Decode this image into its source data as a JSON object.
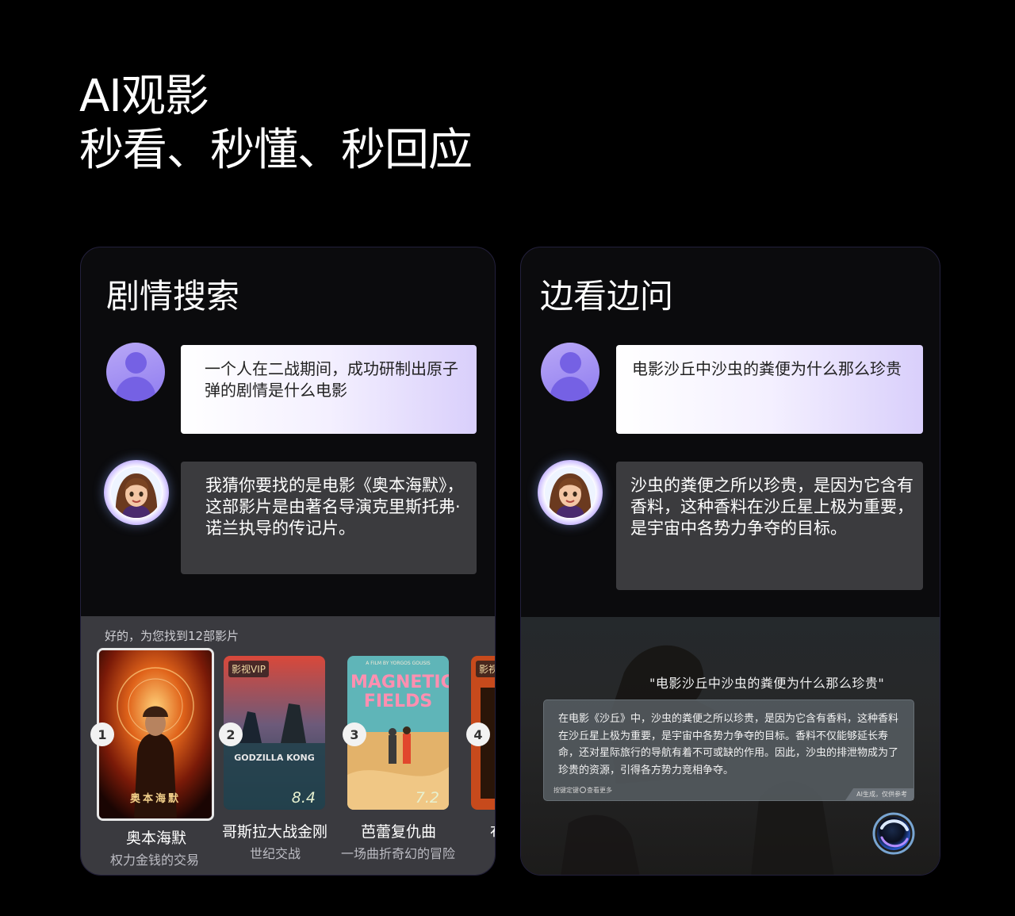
{
  "hero": {
    "line1": "AI观影",
    "line2": "秒看、秒懂、秒回应"
  },
  "left_panel": {
    "title": "剧情搜索",
    "user_message": "一个人在二战期间，成功研制出原子弹的剧情是什么电影",
    "ai_message": "我猜你要找的是电影《奥本海默》，这部影片是由著名导演克里斯托弗·诺兰执导的传记片。",
    "results_caption": "好的，为您找到12部影片",
    "vip_badge": "影视VIP",
    "movies": [
      {
        "rank": "1",
        "title": "奥本海默",
        "tag": "权力金钱的交易",
        "poster_title": "奥本海默",
        "selected": true
      },
      {
        "rank": "2",
        "title": "哥斯拉大战金刚",
        "tag": "世纪交战",
        "rating": "8.4",
        "poster_title": "GODZILLA KONG"
      },
      {
        "rank": "3",
        "title": "芭蕾复仇曲",
        "tag": "一场曲折奇幻的冒险",
        "rating": "7.2",
        "poster_title": "MAGNETIC FIELDS",
        "poster_subtitle": "A FILM BY YORGOS GOUSIS"
      },
      {
        "rank": "4",
        "title": "布",
        "tag": "命"
      }
    ]
  },
  "right_panel": {
    "title": "边看边问",
    "user_message": "电影沙丘中沙虫的粪便为什么那么珍贵",
    "ai_message": "沙虫的粪便之所以珍贵，是因为它含有香料，这种香料在沙丘星上极为重要，是宇宙中各势力争夺的目标。",
    "scene_question": "\"电影沙丘中沙虫的粪便为什么那么珍贵\"",
    "answer_text": "在电影《沙丘》中，沙虫的粪便之所以珍贵，是因为它含有香料，这种香料在沙丘星上极为重要，是宇宙中各势力争夺的目标。香料不仅能够延长寿命，还对星际旅行的导航有着不可或缺的作用。因此，沙虫的排泄物成为了珍贵的资源，引得各方势力竞相争夺。",
    "answer_hint_pre": "按键定键",
    "answer_hint_post": "查看更多",
    "answer_footer": "AI生成，仅供参考"
  },
  "colors": {
    "background": "#000000",
    "panel_bg": "#0b0b0d",
    "panel_border": "#23203c",
    "user_avatar": "#a896f5",
    "ai_bubble": "#3b3b3e",
    "user_bubble_gradient_end": "#d9cffb"
  },
  "icons": [
    "user-avatar-icon",
    "ai-assistant-avatar",
    "ai-orb-icon",
    "ok-button-icon"
  ]
}
